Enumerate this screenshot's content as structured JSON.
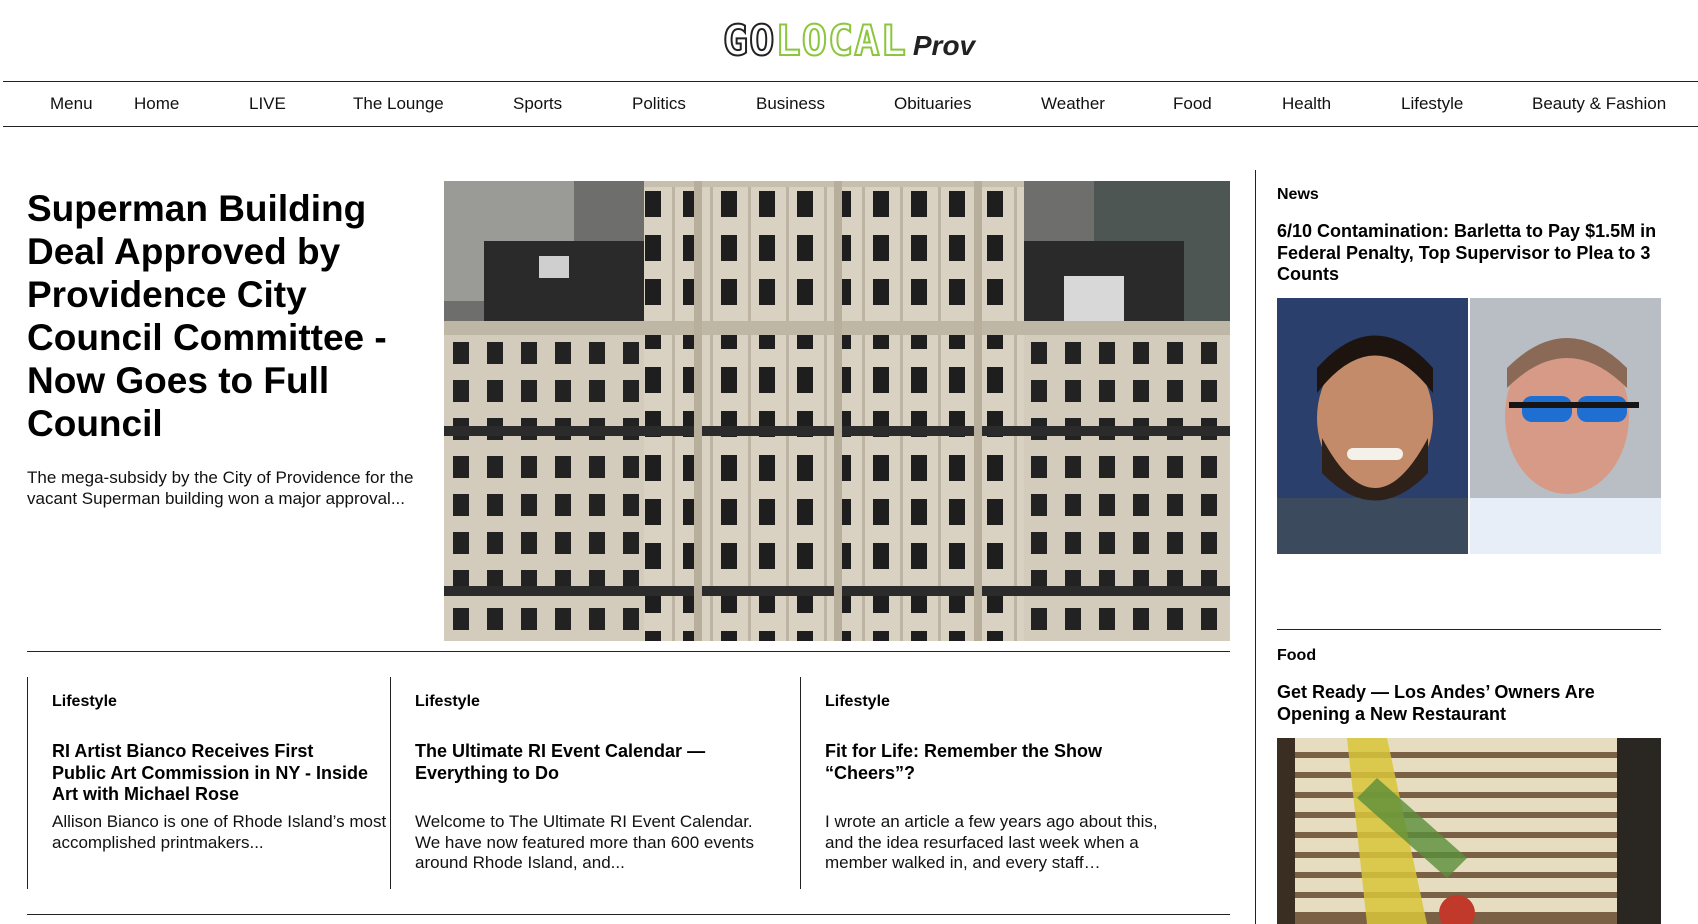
{
  "logo": {
    "go": "GO",
    "local": "LOCAL",
    "prov": "Prov"
  },
  "nav": {
    "menu": "Menu",
    "items": [
      {
        "label": "Home"
      },
      {
        "label": "LIVE"
      },
      {
        "label": "The Lounge"
      },
      {
        "label": "Sports"
      },
      {
        "label": "Politics"
      },
      {
        "label": "Business"
      },
      {
        "label": "Obituaries"
      },
      {
        "label": "Weather"
      },
      {
        "label": "Food"
      },
      {
        "label": "Health"
      },
      {
        "label": "Lifestyle"
      },
      {
        "label": "Beauty & Fashion"
      }
    ]
  },
  "hero": {
    "title": "Superman Building Deal Approved by Providence City Council Committee - Now Goes to Full Council",
    "summary": "The mega-subsidy by the City of Providence for the vacant Superman building won a major approval..."
  },
  "cards": [
    {
      "category": "Lifestyle",
      "title": "RI Artist Bianco Receives First Public Art Commission in NY - Inside Art with Michael Rose",
      "desc": "Allison Bianco is one of Rhode Island’s most accomplished printmakers..."
    },
    {
      "category": "Lifestyle",
      "title": "The Ultimate RI Event Calendar — Everything to Do",
      "desc": "Welcome to The Ultimate RI Event Calendar. We have now featured more than 600 events around Rhode Island, and..."
    },
    {
      "category": "Lifestyle",
      "title": "Fit for Life: Remember the Show “Cheers”?",
      "desc": "I wrote an article a few years ago about this, and the idea resurfaced last week when a member walked in, and every staff…"
    }
  ],
  "sidebar": {
    "news": {
      "category": "News",
      "title": "6/10 Contamination: Barletta to Pay $1.5M in Federal Penalty, Top Supervisor to Plea to 3 Counts"
    },
    "food": {
      "category": "Food",
      "title": "Get Ready — Los Andes’ Owners Are Opening a New Restaurant"
    }
  },
  "colors": {
    "brand_green": "#8cc63f",
    "text": "#000000",
    "rule": "#222222"
  }
}
